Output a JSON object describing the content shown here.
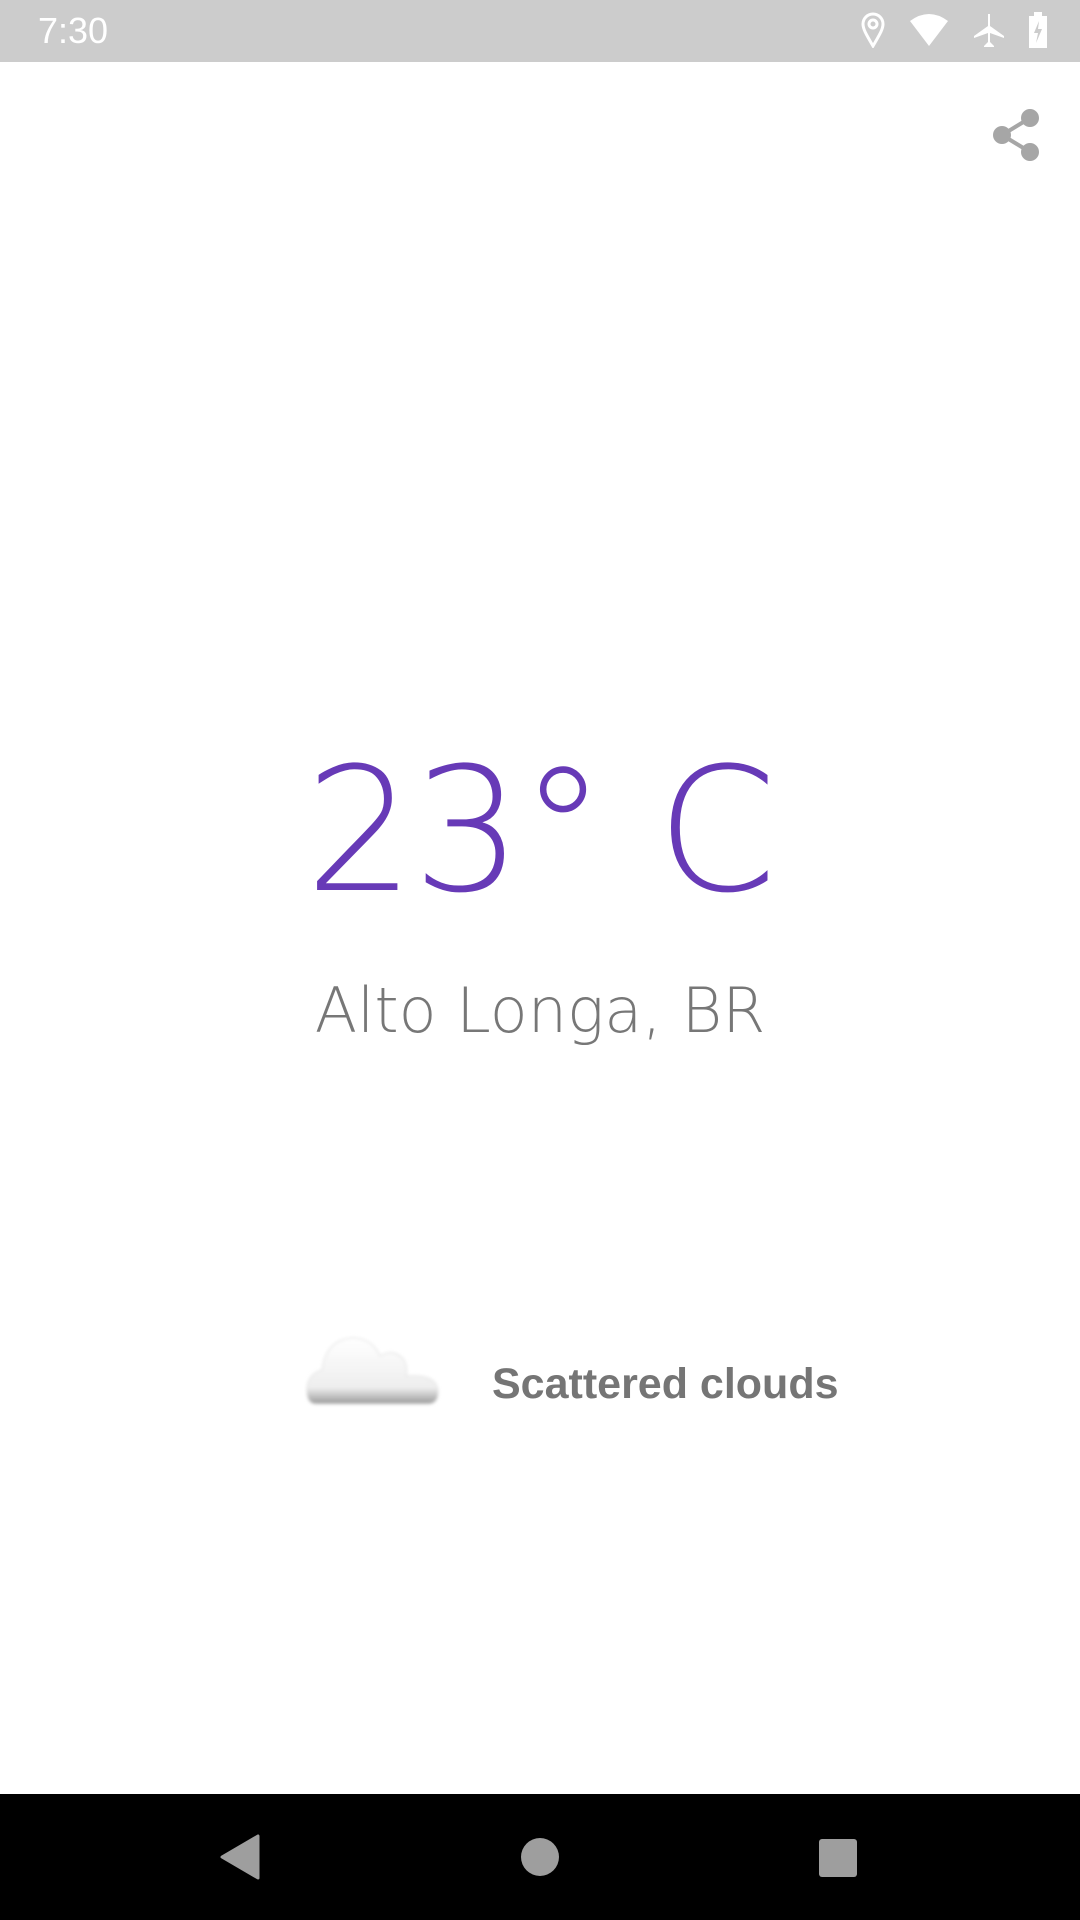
{
  "status_bar": {
    "time": "7:30",
    "icons": [
      "location-icon",
      "wifi-icon",
      "airplane-mode-icon",
      "battery-charging-icon"
    ]
  },
  "toolbar": {
    "share_icon": "share-icon"
  },
  "weather": {
    "temperature": "23° C",
    "location": "Alto Longa, BR",
    "condition_icon": "cloud-icon",
    "description": "Scattered clouds",
    "accent_color": "#673ab7"
  },
  "nav_bar": {
    "icons": [
      "back-icon",
      "home-icon",
      "recents-icon"
    ]
  }
}
